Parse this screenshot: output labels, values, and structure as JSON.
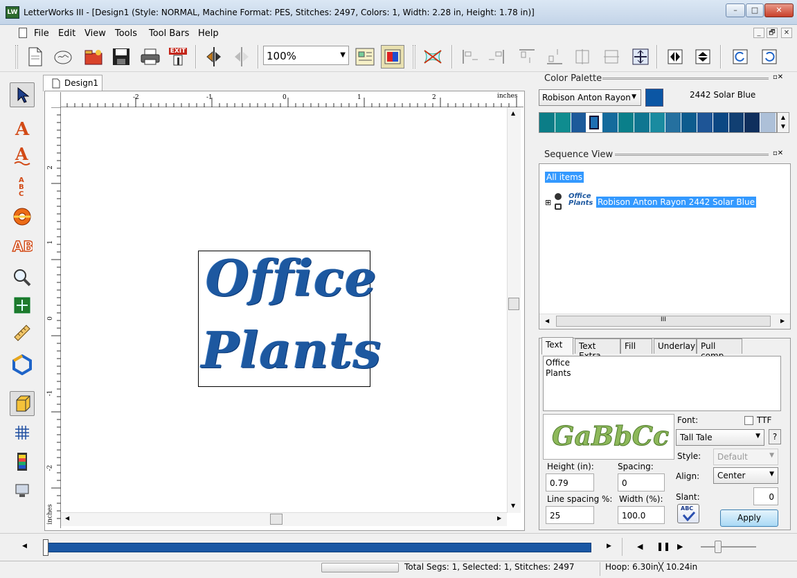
{
  "window": {
    "title": "LetterWorks III - [Design1 (Style: NORMAL, Machine Format: PES, Stitches: 2497, Colors: 1, Width: 2.28 in, Height: 1.78 in)]",
    "app_icon_text": "LW",
    "minimize": "–",
    "maximize": "□",
    "close": "✕"
  },
  "menu": {
    "items": [
      "File",
      "Edit",
      "View",
      "Tools",
      "Tool Bars",
      "Help"
    ],
    "mdi": [
      "_",
      "🗗",
      "✕"
    ]
  },
  "toolbar": {
    "zoom": "100%",
    "exit_label": "EXIT"
  },
  "document": {
    "tab": "Design1",
    "ruler_unit": "inches",
    "h_ticks": [
      "-2",
      "-1",
      "0",
      "1",
      "2"
    ],
    "v_ticks": [
      "2",
      "1",
      "0",
      "-1",
      "-2"
    ],
    "design_lines": [
      "Office",
      "Plants"
    ]
  },
  "color_palette": {
    "title": "Color Palette",
    "brand": "Robison Anton Rayon",
    "selected_color_name": "2442 Solar Blue",
    "selected_color": "#0b56a4",
    "swatches": [
      "#0b7d87",
      "#0f8c8f",
      "#1c5a9a",
      "#1f6fb3",
      "#146b9c",
      "#0a7f8a",
      "#0f7691",
      "#1a8ba0",
      "#25709f",
      "#0d5c8e",
      "#1e5596",
      "#0b4783",
      "#113f72",
      "#0f2f5d",
      "#adc0d8"
    ]
  },
  "sequence_view": {
    "title": "Sequence View",
    "root": "All items",
    "item_label": "Robison Anton Rayon 2442 Solar Blue",
    "item_thumb": [
      "Office",
      "Plants"
    ],
    "expand": "⊞"
  },
  "properties": {
    "tabs": [
      "Text",
      "Text Extra",
      "Fill",
      "Underlay",
      "Pull comp."
    ],
    "text_value": "Office\nPlants",
    "font_preview": "GaBbCc",
    "font_label": "Font:",
    "ttf_label": "TTF",
    "font_value": "Tall Tale",
    "help": "?",
    "style_label": "Style:",
    "style_value": "Default",
    "align_label": "Align:",
    "align_value": "Center",
    "slant_label": "Slant:",
    "slant_value": "0",
    "height_label": "Height (in):",
    "height_value": "0.79",
    "spacing_label": "Spacing:",
    "spacing_value": "0",
    "line_spacing_label": "Line spacing %:",
    "line_spacing_value": "25",
    "width_label": "Width (%):",
    "width_value": "100.0",
    "abc_button": "ABC",
    "apply": "Apply"
  },
  "status": {
    "segments": "Total Segs: 1, Selected: 1, Stitches: 2497",
    "hoop": "Hoop: 6.30in╳ 10.24in"
  },
  "colors": {
    "accent": "#3399ff",
    "thread": "#1d58a0"
  }
}
